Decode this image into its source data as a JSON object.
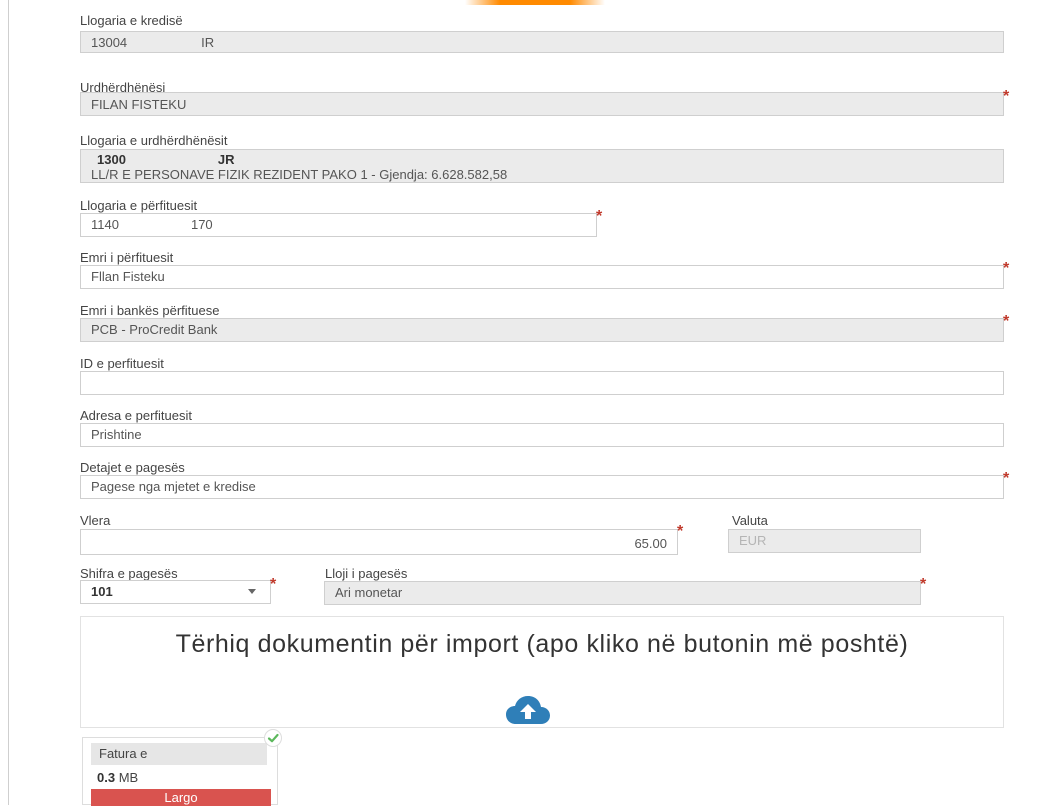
{
  "form": {
    "credit_account": {
      "label": "Llogaria e kredisë",
      "value_start": "13004",
      "value_end": "IR"
    },
    "orderer": {
      "label": "Urdhërdhënësi",
      "value": "FILAN FISTEKU"
    },
    "orderer_account": {
      "label": "Llogaria e urdhërdhënësit",
      "line1_start": "1300",
      "line1_end": "JR",
      "line2": "LL/R E PERSONAVE FIZIK REZIDENT PAKO 1 - Gjendja: 6.628.582,58"
    },
    "beneficiary_account": {
      "label": "Llogaria e përfituesit",
      "value_start": "1140",
      "value_end": "170"
    },
    "beneficiary_name": {
      "label": "Emri i përfituesit",
      "value": "Fllan Fisteku"
    },
    "beneficiary_bank": {
      "label": "Emri i bankës përfituese",
      "value": "PCB - ProCredit Bank"
    },
    "beneficiary_id": {
      "label": "ID e perfituesit",
      "value": ""
    },
    "beneficiary_address": {
      "label": "Adresa e perfituesit",
      "value": "Prishtine"
    },
    "payment_details": {
      "label": "Detajet e pagesës",
      "value": "Pagese nga mjetet e kredise"
    },
    "amount": {
      "label": "Vlera",
      "value": "65.00"
    },
    "currency": {
      "label": "Valuta",
      "value": "EUR"
    },
    "payment_code": {
      "label": "Shifra e pagesës",
      "value": "101"
    },
    "payment_type": {
      "label": "Lloji i pagesës",
      "value": "Ari monetar"
    },
    "required_mark": "*"
  },
  "upload": {
    "dropzone_text": "Tërhiq dokumentin për import (apo kliko në butonin më poshtë)",
    "icon": "cloud-upload-icon",
    "file": {
      "name": "Fatura e",
      "size_value": "0.3",
      "size_unit": "MB",
      "remove_label": "Largo"
    }
  },
  "colors": {
    "required": "#c0392b",
    "remove_button": "#d9534f",
    "upload_icon": "#2f7fb8",
    "check": "#5cb85c",
    "accent": "#ff8a00"
  }
}
